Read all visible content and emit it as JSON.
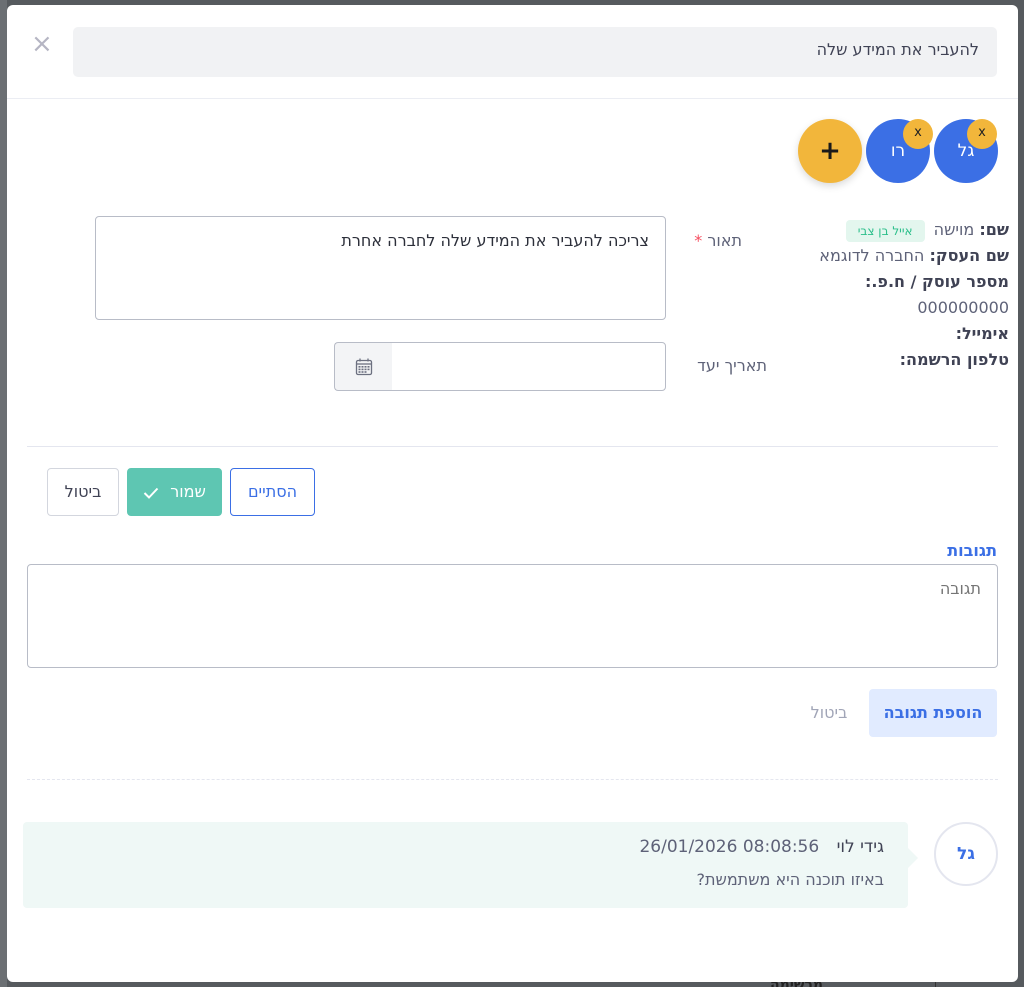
{
  "dialog": {
    "title": "להעביר את המידע שלה",
    "close_glyph": "×"
  },
  "assignees": [
    {
      "initials": "גל",
      "remove": "x"
    },
    {
      "initials": "רו",
      "remove": "x"
    }
  ],
  "add_assignee": "+",
  "contact": {
    "name_label": "שם:",
    "name_value": "מוישה",
    "owner_tag": "אייל בן צבי",
    "business_label": "שם העסק:",
    "business_value": "החברה לדוגמא",
    "id_label": "מספר עוסק / ח.פ.:",
    "id_value": "000000000",
    "email_label": "אימייל:",
    "phone_label": "טלפון הרשמה:"
  },
  "form": {
    "description_label": "תאור",
    "required_mark": "*",
    "description_value": "צריכה להעביר את המידע שלה לחברה אחרת",
    "due_date_label": "תאריך יעד",
    "due_date_value": ""
  },
  "actions": {
    "finish": "הסתיים",
    "save": "שמור",
    "cancel": "ביטול"
  },
  "responses": {
    "title": "תגובות",
    "placeholder": "תגובה",
    "add_button": "הוספת תגובה",
    "cancel_button": "ביטול"
  },
  "comments": [
    {
      "avatar": "גל",
      "author": "גידי לוי",
      "timestamp": "26/01/2026 08:08:56",
      "text": "באיזו תוכנה היא משתמשת?"
    }
  ],
  "background": {
    "partial_text": "מרשימה"
  },
  "colors": {
    "primary": "#3b6fe5",
    "accent_yellow": "#f2b63b",
    "success": "#5ec6b2"
  }
}
